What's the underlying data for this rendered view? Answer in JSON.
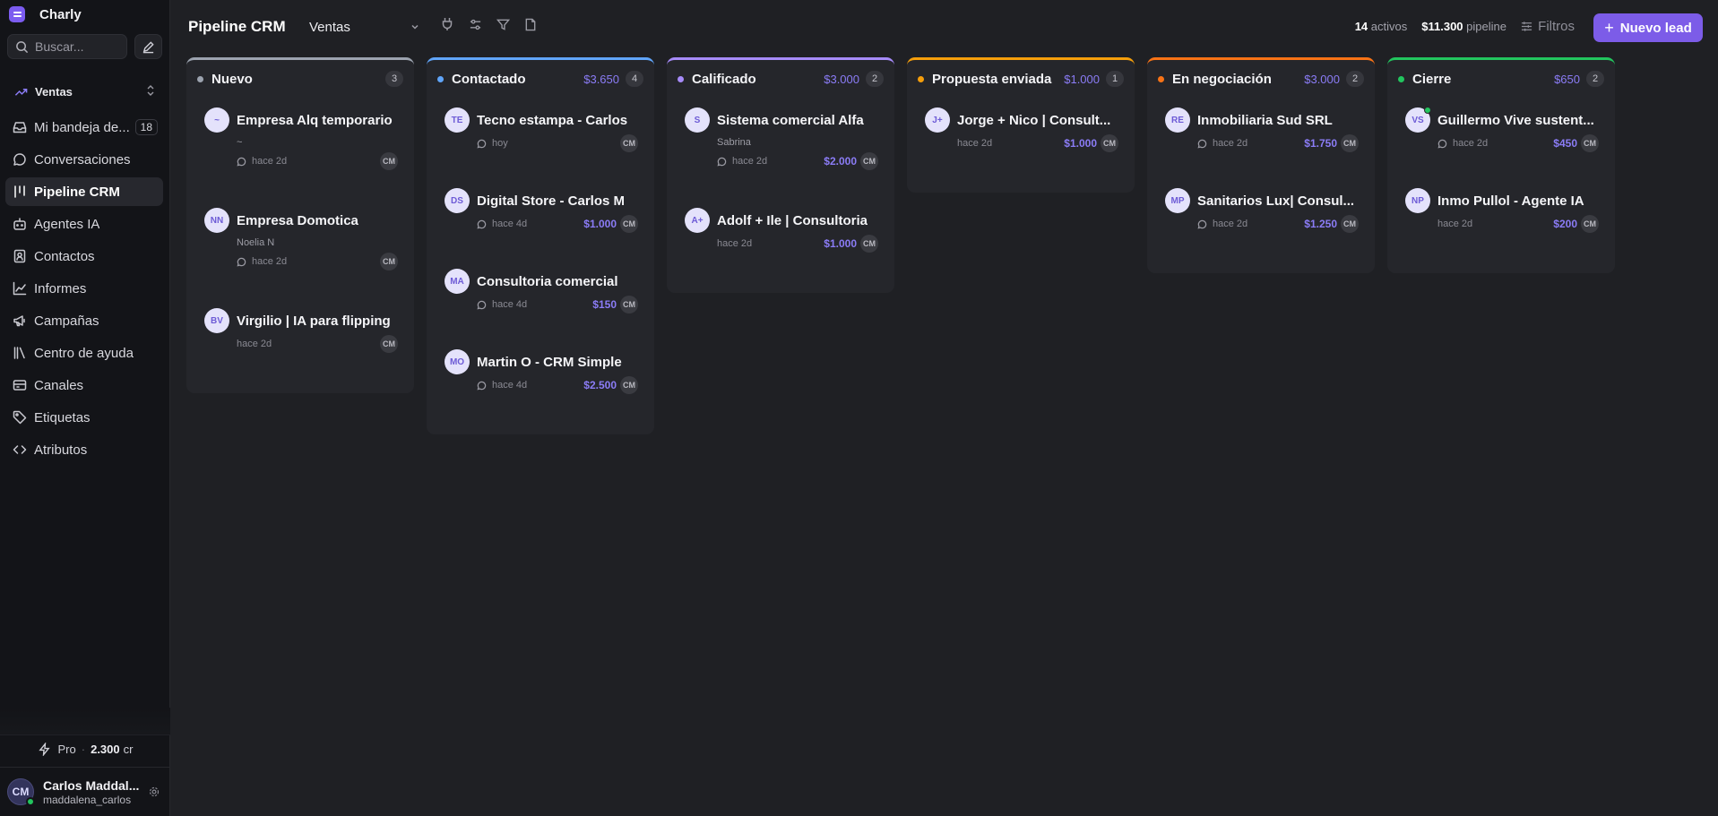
{
  "app": {
    "name": "Charly"
  },
  "sidebar": {
    "search_placeholder": "Buscar...",
    "workspace": "Ventas",
    "items": [
      {
        "label": "Mi bandeja de entrada",
        "icon": "inbox-icon",
        "badge": "18",
        "active": false
      },
      {
        "label": "Conversaciones",
        "icon": "chat-icon",
        "active": false
      },
      {
        "label": "Pipeline CRM",
        "icon": "pipeline-icon",
        "active": true
      },
      {
        "label": "Agentes IA",
        "icon": "bot-icon",
        "active": false
      },
      {
        "label": "Contactos",
        "icon": "contacts-icon",
        "active": false
      },
      {
        "label": "Informes",
        "icon": "chart-icon",
        "active": false
      },
      {
        "label": "Campañas",
        "icon": "megaphone-icon",
        "active": false
      },
      {
        "label": "Centro de ayuda",
        "icon": "library-icon",
        "active": false
      },
      {
        "label": "Canales",
        "icon": "channels-icon",
        "active": false
      },
      {
        "label": "Etiquetas",
        "icon": "tag-icon",
        "active": false
      },
      {
        "label": "Atributos",
        "icon": "code-icon",
        "active": false
      }
    ],
    "plan": {
      "name": "Pro",
      "separator": "·",
      "credits": "2.300",
      "unit": "cr"
    },
    "user": {
      "initials": "CM",
      "name": "Carlos Maddalena",
      "handle": "maddalena_carlos"
    }
  },
  "header": {
    "title": "Pipeline CRM",
    "pipeline": "Ventas",
    "stats": {
      "active_count": "14",
      "active_label": "activos",
      "pipeline_value": "$11.300",
      "pipeline_label": "pipeline"
    },
    "filters_label": "Filtros",
    "new_lead_label": "Nuevo lead"
  },
  "columns": [
    {
      "title": "Nuevo",
      "color": "#9ca3af",
      "amount": "",
      "count": "3",
      "cards": [
        {
          "initials": "~",
          "title": "Empresa Alq temporario",
          "subtitle": "~",
          "time": "hace 2d",
          "chat": true,
          "amount": "",
          "owner": "CM"
        },
        {
          "initials": "NN",
          "title": "Empresa Domotica",
          "subtitle": "Noelia N",
          "time": "hace 2d",
          "chat": true,
          "amount": "",
          "owner": "CM"
        },
        {
          "initials": "BV",
          "title": "Virgilio | IA para flipping",
          "subtitle": "",
          "time": "hace 2d",
          "chat": false,
          "amount": "",
          "owner": "CM"
        }
      ]
    },
    {
      "title": "Contactado",
      "color": "#60a5fa",
      "amount": "$3.650",
      "count": "4",
      "cards": [
        {
          "initials": "TE",
          "title": "Tecno estampa - Carlos",
          "subtitle": "",
          "time": "hoy",
          "chat": true,
          "amount": "",
          "owner": "CM"
        },
        {
          "initials": "DS",
          "title": "Digital Store - Carlos M",
          "subtitle": "",
          "time": "hace 4d",
          "chat": true,
          "amount": "$1.000",
          "owner": "CM"
        },
        {
          "initials": "MA",
          "title": "Consultoria comercial",
          "subtitle": "",
          "time": "hace 4d",
          "chat": true,
          "amount": "$150",
          "owner": "CM"
        },
        {
          "initials": "MO",
          "title": "Martin O - CRM Simple",
          "subtitle": "",
          "time": "hace 4d",
          "chat": true,
          "amount": "$2.500",
          "owner": "CM"
        }
      ]
    },
    {
      "title": "Calificado",
      "color": "#a78bfa",
      "amount": "$3.000",
      "count": "2",
      "cards": [
        {
          "initials": "S",
          "title": "Sistema comercial Alfa",
          "subtitle": "Sabrina",
          "time": "hace 2d",
          "chat": true,
          "amount": "$2.000",
          "owner": "CM"
        },
        {
          "initials": "A+",
          "title": "Adolf + Ile | Consultoria",
          "subtitle": "",
          "time": "hace 2d",
          "chat": false,
          "amount": "$1.000",
          "owner": "CM"
        }
      ]
    },
    {
      "title": "Propuesta enviada",
      "color": "#f59e0b",
      "amount": "$1.000",
      "count": "1",
      "cards": [
        {
          "initials": "J+",
          "title": "Jorge + Nico | Consultoria",
          "subtitle": "",
          "time": "hace 2d",
          "chat": false,
          "amount": "$1.000",
          "owner": "CM"
        }
      ]
    },
    {
      "title": "En negociación",
      "color": "#f97316",
      "amount": "$3.000",
      "count": "2",
      "cards": [
        {
          "initials": "RE",
          "title": "Inmobiliaria Sud SRL",
          "subtitle": "",
          "time": "hace 2d",
          "chat": true,
          "amount": "$1.750",
          "owner": "CM"
        },
        {
          "initials": "MP",
          "title": "Sanitarios Lux| Consultoria",
          "subtitle": "",
          "time": "hace 2d",
          "chat": true,
          "amount": "$1.250",
          "owner": "CM"
        }
      ]
    },
    {
      "title": "Cierre",
      "color": "#22c55e",
      "amount": "$650",
      "count": "2",
      "cards": [
        {
          "initials": "VS",
          "title": "Guillermo Vive sustentable",
          "subtitle": "",
          "time": "hace 2d",
          "chat": true,
          "amount": "$450",
          "owner": "CM",
          "online": true
        },
        {
          "initials": "NP",
          "title": "Inmo Pullol - Agente IA",
          "subtitle": "",
          "time": "hace 2d",
          "chat": false,
          "amount": "$200",
          "owner": "CM"
        }
      ]
    }
  ]
}
